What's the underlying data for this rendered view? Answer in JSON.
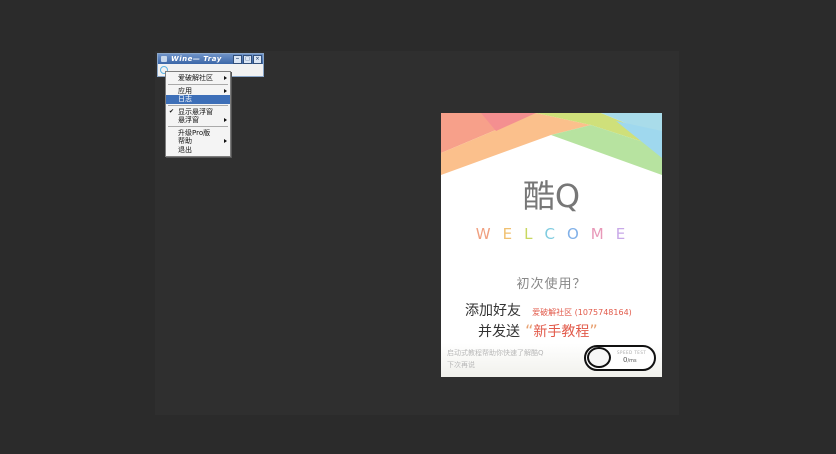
{
  "tray": {
    "title": "Wine— Tray",
    "min_glyph": "‒",
    "max_glyph": "□",
    "close_glyph": "×"
  },
  "menu": {
    "items": [
      {
        "label": "爱破解社区",
        "arrow": true
      },
      {
        "label": "应用",
        "arrow": true
      },
      {
        "label": "日志",
        "selected": true
      },
      {
        "label": "显示悬浮窗",
        "checked": true,
        "check": "✔"
      },
      {
        "label": "悬浮窗",
        "arrow": true
      },
      {
        "label": "升级Pro版"
      },
      {
        "label": "帮助",
        "arrow": true
      },
      {
        "label": "退出"
      }
    ]
  },
  "kuq": {
    "title": "酷Q",
    "welcome_letters": [
      "W",
      "E",
      "L",
      "C",
      "O",
      "M",
      "E"
    ],
    "welcome_colors": [
      "#f0a080",
      "#f0c070",
      "#c8d860",
      "#80cce0",
      "#80b0e8",
      "#e898b8",
      "#c8a8e8"
    ],
    "first_use": "初次使用？",
    "add_friend": "添加好友",
    "friend_name": "爱破解社区 (1075748164)",
    "send": "并发送",
    "open_quote": "“",
    "tutorial": "新手教程",
    "close_quote": "”",
    "footer_line1": "启动式教程帮助你快速了解酷Q",
    "footer_line2": "下次再说",
    "speed_label": "SPEED TEST",
    "speed_value": "0",
    "speed_unit": "/ms"
  }
}
